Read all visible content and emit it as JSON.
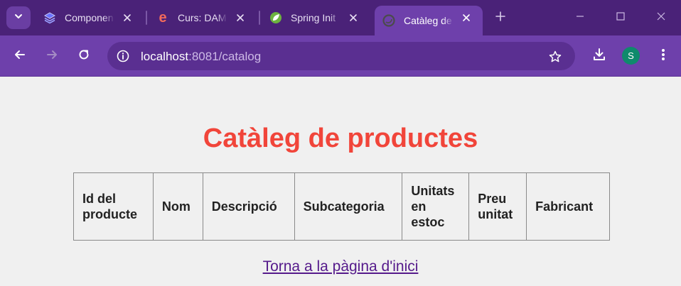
{
  "browser": {
    "tabs": [
      {
        "title": "Componen",
        "icon": "layers-favicon-icon",
        "active": false
      },
      {
        "title": "Curs: DAM",
        "icon": "moodle-e-favicon-icon",
        "active": false
      },
      {
        "title": "Spring Init",
        "icon": "spring-leaf-favicon-icon",
        "active": false
      },
      {
        "title": "Catàleg de",
        "icon": "globe-favicon-icon",
        "active": true
      }
    ],
    "url_host": "localhost",
    "url_rest": ":8081/catalog",
    "profile_initial": "S",
    "colors": {
      "frame": "#4a2278",
      "toolbar": "#6e40ab",
      "omnibox": "#5a2f91",
      "avatar": "#0f8a6c"
    }
  },
  "page": {
    "title": "Catàleg de productes",
    "table_headers": [
      "Id del producte",
      "Nom",
      "Descripció",
      "Subcategoria",
      "Unitats en estoc",
      "Preu unitat",
      "Fabricant"
    ],
    "back_link": "Torna a la pàgina d'inici",
    "colors": {
      "title": "#f1453a",
      "link": "#551a8b"
    }
  }
}
